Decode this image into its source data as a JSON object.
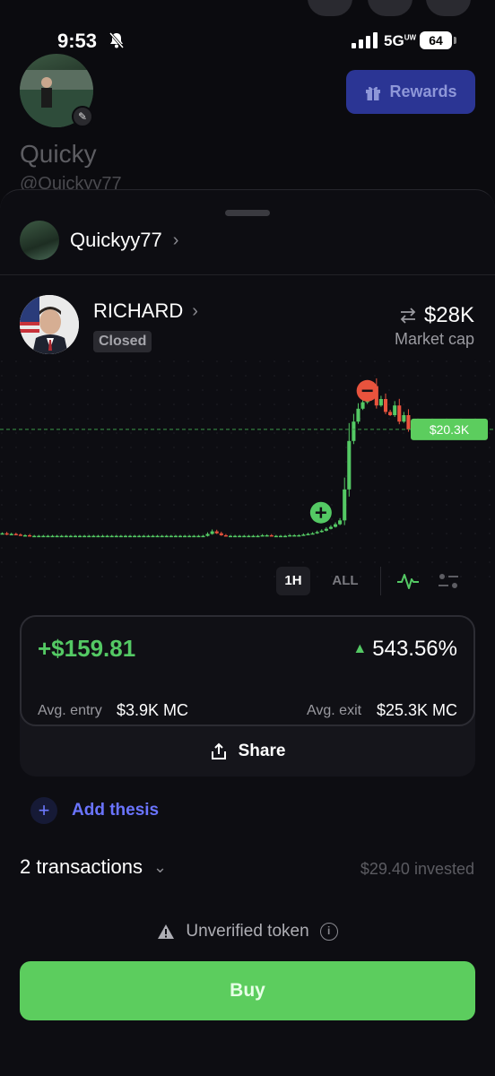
{
  "status_bar": {
    "time": "9:53",
    "network": "5G",
    "network_sub": "UW",
    "battery": "64"
  },
  "profile": {
    "name": "Quicky",
    "handle": "@Quickyy77",
    "rewards_label": "Rewards"
  },
  "sheet": {
    "owner_name": "Quickyy77",
    "token": {
      "name": "RICHARD",
      "status": "Closed",
      "market_cap": "$28K",
      "market_cap_label": "Market cap"
    },
    "chart": {
      "current_price_label": "$20.3K"
    },
    "timeframes": [
      "1H",
      "ALL"
    ],
    "pnl": {
      "amount": "+$159.81",
      "percent": "543.56%",
      "avg_entry_label": "Avg. entry",
      "avg_entry_value": "$3.9K MC",
      "avg_exit_label": "Avg. exit",
      "avg_exit_value": "$25.3K MC",
      "share_label": "Share"
    },
    "add_thesis_label": "Add thesis",
    "transactions_label": "2 transactions",
    "invested_label": "$29.40 invested",
    "unverified_label": "Unverified token",
    "buy_label": "Buy"
  },
  "colors": {
    "accent_green": "#5ccd5e",
    "loss_red": "#e8533d",
    "link_blue": "#6a74ff",
    "rewards_blue": "#2b3594"
  },
  "chart_data": {
    "type": "candlestick",
    "x": [
      1,
      2,
      3,
      4,
      5,
      6,
      7,
      8,
      9,
      10,
      11,
      12,
      13,
      14,
      15,
      16,
      17,
      18,
      19,
      20,
      21,
      22,
      23,
      24,
      25,
      26,
      27,
      28,
      29,
      30,
      31,
      32,
      33,
      34,
      35,
      36,
      37,
      38,
      39,
      40,
      41,
      42,
      43,
      44,
      45,
      46,
      47,
      48,
      49,
      50,
      51,
      52,
      53,
      54,
      55,
      56,
      57,
      58,
      59,
      60,
      61,
      62,
      63,
      64,
      65,
      66,
      67,
      68,
      69,
      70,
      71,
      72,
      73,
      74,
      75,
      76,
      77,
      78,
      79,
      80,
      81,
      82,
      83,
      84,
      85,
      86,
      87,
      88,
      89,
      90
    ],
    "close": [
      4.2,
      4.0,
      4.1,
      4.0,
      3.9,
      3.9,
      3.8,
      3.8,
      3.8,
      3.8,
      3.8,
      3.8,
      3.8,
      3.8,
      3.8,
      3.8,
      3.8,
      3.8,
      3.8,
      3.8,
      3.8,
      3.8,
      3.8,
      3.8,
      3.8,
      3.8,
      3.8,
      3.8,
      3.8,
      3.8,
      3.8,
      3.8,
      3.8,
      3.8,
      3.8,
      3.8,
      3.8,
      3.8,
      3.8,
      3.8,
      3.8,
      3.8,
      3.8,
      3.8,
      3.8,
      4.1,
      4.5,
      4.2,
      3.9,
      3.8,
      3.8,
      3.8,
      3.8,
      3.8,
      3.8,
      3.8,
      3.8,
      3.9,
      3.9,
      3.8,
      3.8,
      3.8,
      3.8,
      3.9,
      3.9,
      3.9,
      4.0,
      4.1,
      4.2,
      4.4,
      4.6,
      4.9,
      5.2,
      5.6,
      6.2,
      11.0,
      18.5,
      21.5,
      23.5,
      24.5,
      26.0,
      27.0,
      24.0,
      25.0,
      23.0,
      22.5,
      24.0,
      21.5,
      22.5,
      20.3
    ],
    "events": [
      {
        "type": "buy",
        "x": 72
      },
      {
        "type": "sell",
        "x": 81
      }
    ]
  }
}
